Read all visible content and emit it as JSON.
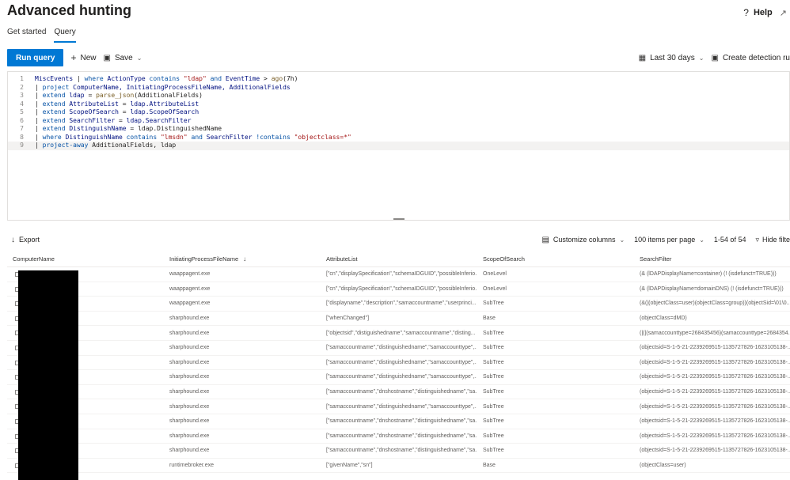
{
  "header": {
    "title": "Advanced hunting",
    "help_label": "Help",
    "help_icon": "question-icon",
    "expand_icon": "expand-icon"
  },
  "tabs": [
    {
      "label": "Get started"
    },
    {
      "label": "Query",
      "active": true
    }
  ],
  "toolbar": {
    "run_label": "Run query",
    "new_label": "New",
    "save_label": "Save",
    "time_range": "Last 30 days",
    "create_rule_label": "Create detection ru"
  },
  "editor": {
    "lines": [
      {
        "n": "1",
        "tokens": [
          [
            "id",
            "MiscEvents "
          ],
          [
            "plain",
            "| "
          ],
          [
            "kw",
            "where "
          ],
          [
            "id",
            "ActionType "
          ],
          [
            "kw",
            "contains "
          ],
          [
            "str",
            "\"ldap\""
          ],
          [
            "kw",
            " and "
          ],
          [
            "id",
            "EventTime "
          ],
          [
            "plain",
            "> "
          ],
          [
            "fn",
            "ago"
          ],
          [
            "plain",
            "(7h)"
          ]
        ]
      },
      {
        "n": "2",
        "tokens": [
          [
            "plain",
            "| "
          ],
          [
            "kw",
            "project "
          ],
          [
            "id",
            "ComputerName, InitiatingProcessFileName, AdditionalFields"
          ]
        ]
      },
      {
        "n": "3",
        "tokens": [
          [
            "plain",
            "| "
          ],
          [
            "kw",
            "extend "
          ],
          [
            "id",
            "ldap "
          ],
          [
            "plain",
            "= "
          ],
          [
            "fn",
            "parse_json"
          ],
          [
            "plain",
            "(AdditionalFields)"
          ]
        ]
      },
      {
        "n": "4",
        "tokens": [
          [
            "plain",
            "| "
          ],
          [
            "kw",
            "extend "
          ],
          [
            "id",
            "AttributeList "
          ],
          [
            "plain",
            "= "
          ],
          [
            "id",
            "ldap.AttributeList"
          ]
        ]
      },
      {
        "n": "5",
        "tokens": [
          [
            "plain",
            "| "
          ],
          [
            "kw",
            "extend "
          ],
          [
            "id",
            "ScopeOfSearch "
          ],
          [
            "plain",
            "= "
          ],
          [
            "id",
            "ldap.ScopeOfSearch"
          ]
        ]
      },
      {
        "n": "6",
        "tokens": [
          [
            "plain",
            "| "
          ],
          [
            "kw",
            "extend "
          ],
          [
            "id",
            "SearchFilter "
          ],
          [
            "plain",
            "= "
          ],
          [
            "id",
            "ldap.SearchFilter"
          ]
        ]
      },
      {
        "n": "7",
        "tokens": [
          [
            "plain",
            "| "
          ],
          [
            "kw",
            "extend "
          ],
          [
            "id",
            "DistinguishName "
          ],
          [
            "plain",
            "= "
          ],
          [
            "plain",
            "ldap.DistinguishedName"
          ]
        ]
      },
      {
        "n": "8",
        "tokens": [
          [
            "plain",
            "| "
          ],
          [
            "kw",
            "where "
          ],
          [
            "id",
            "DistinguishName "
          ],
          [
            "kw",
            "contains "
          ],
          [
            "str",
            "\"lmsdn\""
          ],
          [
            "kw",
            " and "
          ],
          [
            "id",
            "SearchFilter "
          ],
          [
            "kw",
            "!contains "
          ],
          [
            "str",
            "\"objectclass=*\""
          ]
        ]
      },
      {
        "n": "9",
        "tokens": [
          [
            "plain",
            "| "
          ],
          [
            "kw",
            "project-away "
          ],
          [
            "plain",
            "AdditionalFields, ldap"
          ]
        ]
      }
    ]
  },
  "results_toolbar": {
    "export_label": "Export",
    "customize_label": "Customize columns",
    "per_page_label": "100 items per page",
    "count_label": "1-54 of 54",
    "hide_filter_label": "Hide filte"
  },
  "table": {
    "columns": [
      "ComputerName",
      "InitiatingProcessFileName",
      "AttributeList",
      "ScopeOfSearch",
      "SearchFilter"
    ],
    "rows": [
      [
        "",
        "waappagent.exe",
        "[\"cn\",\"displaySpecification\",\"schemaIDGUID\",\"possibleInferio...",
        "OneLevel",
        "(& (lDAPDisplayName=container) (! (isdefunct=TRUE)))"
      ],
      [
        "",
        "waappagent.exe",
        "[\"cn\",\"displaySpecification\",\"schemaIDGUID\",\"possibleInferio...",
        "OneLevel",
        "(& (lDAPDisplayName=domainDNS) (! (isdefunct=TRUE)))"
      ],
      [
        "",
        "waappagent.exe",
        "[\"displayname\",\"description\",\"samaccountname\",\"userprinci...",
        "SubTree",
        "(&(|(objectClass=user)(objectClass=group))(objectSid=\\01\\0..."
      ],
      [
        "",
        "sharphound.exe",
        "[\"whenChanged\"]",
        "Base",
        "(objectClass=dMD)"
      ],
      [
        "",
        "sharphound.exe",
        "[\"objectsid\",\"distiguishedname\",\"samaccountname\",\"disting...",
        "SubTree",
        "(|(|(samaccounttype=268435456)(samaccounttype=2684354..."
      ],
      [
        "",
        "sharphound.exe",
        "[\"samaccountname\",\"distinguishedname\",\"samaccounttype\",...",
        "SubTree",
        "(objectsid=S-1-5-21-2239269515-1135727826-1623105138-..."
      ],
      [
        "",
        "sharphound.exe",
        "[\"samaccountname\",\"distinguishedname\",\"samaccounttype\",...",
        "SubTree",
        "(objectsid=S-1-5-21-2239269515-1135727826-1623105138-..."
      ],
      [
        "",
        "sharphound.exe",
        "[\"samaccountname\",\"distinguishedname\",\"samaccounttype\",...",
        "SubTree",
        "(objectsid=S-1-5-21-2239269515-1135727826-1623105138-..."
      ],
      [
        "",
        "sharphound.exe",
        "[\"samaccountname\",\"dnshostname\",\"distinguishedname\",\"sa...",
        "SubTree",
        "(objectsid=S-1-5-21-2239269515-1135727826-1623105138-..."
      ],
      [
        "",
        "sharphound.exe",
        "[\"samaccountname\",\"distinguishedname\",\"samaccounttype\",...",
        "SubTree",
        "(objectsid=S-1-5-21-2239269515-1135727826-1623105138-..."
      ],
      [
        "",
        "sharphound.exe",
        "[\"samaccountname\",\"dnshostname\",\"distinguishedname\",\"sa...",
        "SubTree",
        "(objectsid=S-1-5-21-2239269515-1135727826-1623105138-..."
      ],
      [
        "",
        "sharphound.exe",
        "[\"samaccountname\",\"dnshostname\",\"distinguishedname\",\"sa...",
        "SubTree",
        "(objectsid=S-1-5-21-2239269515-1135727826-1623105138-..."
      ],
      [
        "",
        "sharphound.exe",
        "[\"samaccountname\",\"dnshostname\",\"distinguishedname\",\"sa...",
        "SubTree",
        "(objectsid=S-1-5-21-2239269515-1135727826-1623105138-..."
      ],
      [
        "",
        "runtimebroker.exe",
        "[\"givenName\",\"sn\"]",
        "Base",
        "(objectClass=user)"
      ]
    ]
  },
  "colors": {
    "accent": "#0078d4",
    "redaction": "#000000"
  }
}
